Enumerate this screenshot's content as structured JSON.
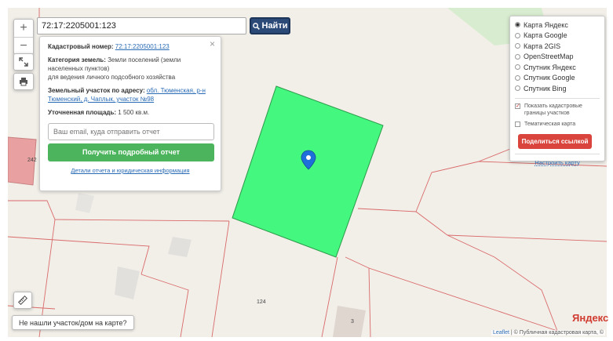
{
  "search": {
    "value": "72:17:2205001:123",
    "button_label": "Найти"
  },
  "zoom": {
    "in_label": "+",
    "out_label": "−"
  },
  "info": {
    "close": "×",
    "cadastral_label": "Кадастровый номер:",
    "cadastral_value": "72:17:2205001:123",
    "category_label": "Категория земель:",
    "category_value": "Земли поселений (земли населенных пунктов)",
    "category_use": "для ведения личного подсобного хозяйства",
    "address_label": "Земельный участок по адресу:",
    "address_value": "обл. Тюменская, р-н Тюменский, д. Чаплык, участок №98",
    "area_label": "Уточненная площадь:",
    "area_value": "1 500 кв.м.",
    "email_placeholder": "Ваш email, куда отправить отчет",
    "report_button": "Получить подробный отчет",
    "details_link": "Детали отчета и юридическая информация"
  },
  "layers": {
    "options": [
      {
        "label": "Карта Яндекс",
        "selected": true
      },
      {
        "label": "Карта Google",
        "selected": false
      },
      {
        "label": "Карта 2GIS",
        "selected": false
      },
      {
        "label": "OpenStreetMap",
        "selected": false
      },
      {
        "label": "Спутник Яндекс",
        "selected": false
      },
      {
        "label": "Спутник Google",
        "selected": false
      },
      {
        "label": "Спутник Bing",
        "selected": false
      }
    ],
    "show_cadastral": {
      "label": "Показать кадастровые границы участков",
      "checked": true
    },
    "thematic": {
      "label": "Тематическая карта",
      "checked": false
    },
    "share_button": "Поделиться ссылкой",
    "setup_link": "Настроить карту"
  },
  "map": {
    "label_242": "242",
    "label_124": "124",
    "label_3": "3",
    "not_found": "Не нашли участок/дом на карте?",
    "attribution_leaflet": "Leaflet",
    "attribution_rest": "| © Публичная кадастровая карта, ©",
    "yandex": "Яндекс"
  },
  "colors": {
    "parcel": "#44f77f",
    "find_button": "#2b4a78",
    "report_button": "#4bb45c",
    "share_button": "#d9453c",
    "pin": "#1e6fd9"
  },
  "icons": [
    "zoom-in-icon",
    "zoom-out-icon",
    "fullscreen-icon",
    "print-icon",
    "search-icon",
    "close-icon",
    "map-pin-icon",
    "ruler-icon"
  ]
}
